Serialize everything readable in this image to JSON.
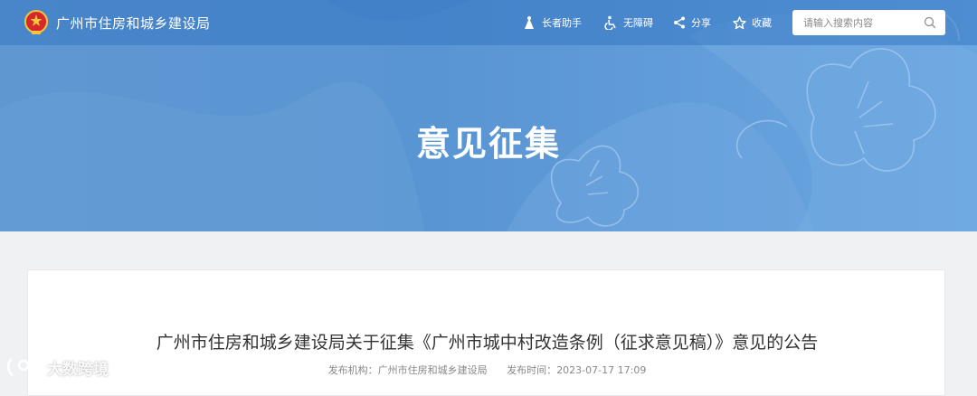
{
  "header": {
    "site_name": "广州市住房和城乡建设局",
    "tools": {
      "elder_mode": "长者助手",
      "accessibility": "无障碍",
      "share": "分享",
      "favorite": "收藏"
    },
    "search": {
      "placeholder": "请输入搜索内容"
    }
  },
  "banner": {
    "title": "意见征集"
  },
  "article": {
    "title": "广州市住房和城乡建设局关于征集《广州市城中村改造条例（征求意见稿）》意见的公告",
    "publisher_label": "发布机构：",
    "publisher": "广州市住房和城乡建设局",
    "date_label": "发布时间：",
    "date": "2023-07-17 17:09"
  },
  "watermark": {
    "text": "大数跨境"
  },
  "colors": {
    "banner_blue": "#5f97d1",
    "topbar_overlay": "#2d6ebe",
    "emblem_red": "#d4282a",
    "emblem_gold": "#f3c63b",
    "text_dark": "#333333",
    "text_meta": "#888888"
  }
}
